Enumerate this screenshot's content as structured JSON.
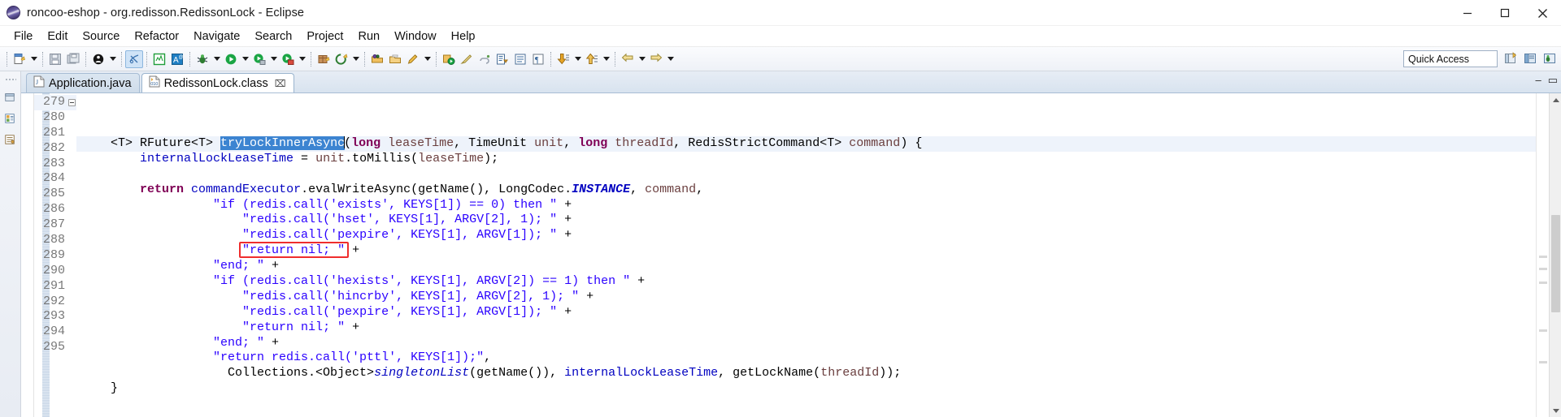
{
  "window": {
    "title": "roncoo-eshop - org.redisson.RedissonLock - Eclipse",
    "app_icon": "eclipse-icon",
    "minimize_label": "—",
    "maximize_label": "❐",
    "close_label": "✕"
  },
  "menu": {
    "items": [
      {
        "label": "File"
      },
      {
        "label": "Edit"
      },
      {
        "label": "Source"
      },
      {
        "label": "Refactor"
      },
      {
        "label": "Navigate"
      },
      {
        "label": "Search"
      },
      {
        "label": "Project"
      },
      {
        "label": "Run"
      },
      {
        "label": "Window"
      },
      {
        "label": "Help"
      }
    ]
  },
  "toolbar": {
    "quick_access_text": "Quick Access",
    "buttons": [
      {
        "name": "new-wizard",
        "icon": "new-file-icon"
      },
      {
        "name": "save",
        "icon": "save-icon"
      },
      {
        "name": "save-all",
        "icon": "save-all-icon"
      },
      {
        "name": "print",
        "icon": "print-icon"
      },
      {
        "name": "toggle-mark-occurrences",
        "icon": "mark-occurrences-icon"
      },
      {
        "name": "new-java-project",
        "icon": "java-project-icon"
      },
      {
        "name": "new-annotation",
        "icon": "annotation-icon"
      },
      {
        "name": "debug",
        "icon": "bug-icon"
      },
      {
        "name": "run",
        "icon": "run-icon"
      },
      {
        "name": "run-external-tools",
        "icon": "external-tools-icon"
      },
      {
        "name": "coverage",
        "icon": "coverage-icon"
      },
      {
        "name": "new-package",
        "icon": "package-icon"
      },
      {
        "name": "git-repository",
        "icon": "git-icon"
      },
      {
        "name": "open-type",
        "icon": "open-type-icon"
      },
      {
        "name": "open-task",
        "icon": "open-task-icon"
      },
      {
        "name": "search",
        "icon": "search-pencil-icon"
      },
      {
        "name": "profile",
        "icon": "profile-icon"
      },
      {
        "name": "brush",
        "icon": "brush-icon"
      },
      {
        "name": "link",
        "icon": "link-icon"
      },
      {
        "name": "next-annotation",
        "icon": "next-annotation-icon"
      },
      {
        "name": "previous-annotation",
        "icon": "previous-annotation-icon"
      },
      {
        "name": "pilcrow",
        "icon": "pilcrow-icon"
      },
      {
        "name": "next-edit",
        "icon": "arrow-down-icon"
      },
      {
        "name": "previous-edit",
        "icon": "arrow-up-icon"
      },
      {
        "name": "back",
        "icon": "back-arrow-icon"
      },
      {
        "name": "forward",
        "icon": "forward-arrow-icon"
      }
    ],
    "perspective_buttons": [
      {
        "name": "open-perspective",
        "icon": "open-perspective-icon"
      },
      {
        "name": "java-perspective",
        "icon": "java-perspective-icon"
      },
      {
        "name": "debug-perspective",
        "icon": "debug-perspective-icon"
      }
    ]
  },
  "editor": {
    "tabs": [
      {
        "label": "Application.java",
        "icon": "java-file-icon",
        "active": false,
        "closable": false
      },
      {
        "label": "RedissonLock.class",
        "icon": "class-file-icon",
        "active": true,
        "closable": true,
        "close_glyph": "⌧"
      }
    ],
    "tab_controls": {
      "minimize_glyph": "–",
      "maximize_glyph": "▭"
    },
    "current_line": 279,
    "first_line": 279,
    "line_numbers": [
      279,
      280,
      281,
      282,
      283,
      284,
      285,
      286,
      287,
      288,
      289,
      290,
      291,
      292,
      293,
      294,
      295
    ],
    "fold_lines": [
      279
    ],
    "selection": "tryLockInnerAsync",
    "annotation": {
      "type": "red-rectangle",
      "color": "#ef2d2d",
      "target_line": 286,
      "target_text": "\"return nil; \""
    },
    "lines": [
      {
        "n": 279,
        "tokens": [
          {
            "t": "    ",
            "c": "plain"
          },
          {
            "t": "<T> RFuture<T> ",
            "c": "plain"
          },
          {
            "t": "tryLockInnerAsync",
            "c": "hl"
          },
          {
            "t": "CARET",
            "c": "caret"
          },
          {
            "t": "(",
            "c": "plain"
          },
          {
            "t": "long",
            "c": "kw"
          },
          {
            "t": " ",
            "c": "plain"
          },
          {
            "t": "leaseTime",
            "c": "param"
          },
          {
            "t": ", TimeUnit ",
            "c": "plain"
          },
          {
            "t": "unit",
            "c": "param"
          },
          {
            "t": ", ",
            "c": "plain"
          },
          {
            "t": "long",
            "c": "kw"
          },
          {
            "t": " ",
            "c": "plain"
          },
          {
            "t": "threadId",
            "c": "param"
          },
          {
            "t": ", RedisStrictCommand<T> ",
            "c": "plain"
          },
          {
            "t": "command",
            "c": "param"
          },
          {
            "t": ") {",
            "c": "plain"
          }
        ]
      },
      {
        "n": 280,
        "tokens": [
          {
            "t": "        ",
            "c": "plain"
          },
          {
            "t": "internalLockLeaseTime",
            "c": "fld"
          },
          {
            "t": " = ",
            "c": "plain"
          },
          {
            "t": "unit",
            "c": "param"
          },
          {
            "t": ".toMillis(",
            "c": "plain"
          },
          {
            "t": "leaseTime",
            "c": "param"
          },
          {
            "t": ");",
            "c": "plain"
          }
        ]
      },
      {
        "n": 281,
        "tokens": []
      },
      {
        "n": 282,
        "tokens": [
          {
            "t": "        ",
            "c": "plain"
          },
          {
            "t": "return",
            "c": "kw"
          },
          {
            "t": " ",
            "c": "plain"
          },
          {
            "t": "commandExecutor",
            "c": "fld"
          },
          {
            "t": ".evalWriteAsync(getName(), LongCodec.",
            "c": "plain"
          },
          {
            "t": "INSTANCE",
            "c": "sfld"
          },
          {
            "t": ", ",
            "c": "plain"
          },
          {
            "t": "command",
            "c": "param"
          },
          {
            "t": ",",
            "c": "plain"
          }
        ]
      },
      {
        "n": 283,
        "tokens": [
          {
            "t": "                  ",
            "c": "plain"
          },
          {
            "t": "\"if (redis.call('exists', KEYS[1]) == 0) then \"",
            "c": "str"
          },
          {
            "t": " +",
            "c": "plain"
          }
        ]
      },
      {
        "n": 284,
        "tokens": [
          {
            "t": "                      ",
            "c": "plain"
          },
          {
            "t": "\"redis.call('hset', KEYS[1], ARGV[2], 1); \"",
            "c": "str"
          },
          {
            "t": " +",
            "c": "plain"
          }
        ]
      },
      {
        "n": 285,
        "tokens": [
          {
            "t": "                      ",
            "c": "plain"
          },
          {
            "t": "\"redis.call('pexpire', KEYS[1], ARGV[1]); \"",
            "c": "str"
          },
          {
            "t": " +",
            "c": "plain"
          }
        ]
      },
      {
        "n": 286,
        "tokens": [
          {
            "t": "                      ",
            "c": "plain"
          },
          {
            "t": "\"return nil; \"",
            "c": "str"
          },
          {
            "t": " +",
            "c": "plain"
          }
        ]
      },
      {
        "n": 287,
        "tokens": [
          {
            "t": "                  ",
            "c": "plain"
          },
          {
            "t": "\"end; \"",
            "c": "str"
          },
          {
            "t": " +",
            "c": "plain"
          }
        ]
      },
      {
        "n": 288,
        "tokens": [
          {
            "t": "                  ",
            "c": "plain"
          },
          {
            "t": "\"if (redis.call('hexists', KEYS[1], ARGV[2]) == 1) then \"",
            "c": "str"
          },
          {
            "t": " +",
            "c": "plain"
          }
        ]
      },
      {
        "n": 289,
        "tokens": [
          {
            "t": "                      ",
            "c": "plain"
          },
          {
            "t": "\"redis.call('hincrby', KEYS[1], ARGV[2], 1); \"",
            "c": "str"
          },
          {
            "t": " +",
            "c": "plain"
          }
        ]
      },
      {
        "n": 290,
        "tokens": [
          {
            "t": "                      ",
            "c": "plain"
          },
          {
            "t": "\"redis.call('pexpire', KEYS[1], ARGV[1]); \"",
            "c": "str"
          },
          {
            "t": " +",
            "c": "plain"
          }
        ]
      },
      {
        "n": 291,
        "tokens": [
          {
            "t": "                      ",
            "c": "plain"
          },
          {
            "t": "\"return nil; \"",
            "c": "str"
          },
          {
            "t": " +",
            "c": "plain"
          }
        ]
      },
      {
        "n": 292,
        "tokens": [
          {
            "t": "                  ",
            "c": "plain"
          },
          {
            "t": "\"end; \"",
            "c": "str"
          },
          {
            "t": " +",
            "c": "plain"
          }
        ]
      },
      {
        "n": 293,
        "tokens": [
          {
            "t": "                  ",
            "c": "plain"
          },
          {
            "t": "\"return redis.call('pttl', KEYS[1]);\"",
            "c": "str"
          },
          {
            "t": ",",
            "c": "plain"
          }
        ]
      },
      {
        "n": 294,
        "tokens": [
          {
            "t": "                    ",
            "c": "plain"
          },
          {
            "t": "Collections.<Object>",
            "c": "plain"
          },
          {
            "t": "singletonList",
            "c": "sm"
          },
          {
            "t": "(getName()), ",
            "c": "plain"
          },
          {
            "t": "internalLockLeaseTime",
            "c": "fld"
          },
          {
            "t": ", getLockName(",
            "c": "plain"
          },
          {
            "t": "threadId",
            "c": "param"
          },
          {
            "t": "));",
            "c": "plain"
          }
        ]
      },
      {
        "n": 295,
        "tokens": [
          {
            "t": "    }",
            "c": "plain"
          }
        ]
      }
    ],
    "overview_marks": [
      200,
      215,
      232,
      291,
      330
    ]
  },
  "colors": {
    "selection_bg": "#3c84d1",
    "string": "#2a00ff",
    "keyword": "#7f0055",
    "field": "#0000c0",
    "parameter": "#6a3e3e",
    "annotation_red": "#ef2d2d",
    "current_line_bg": "#eef3fb"
  }
}
